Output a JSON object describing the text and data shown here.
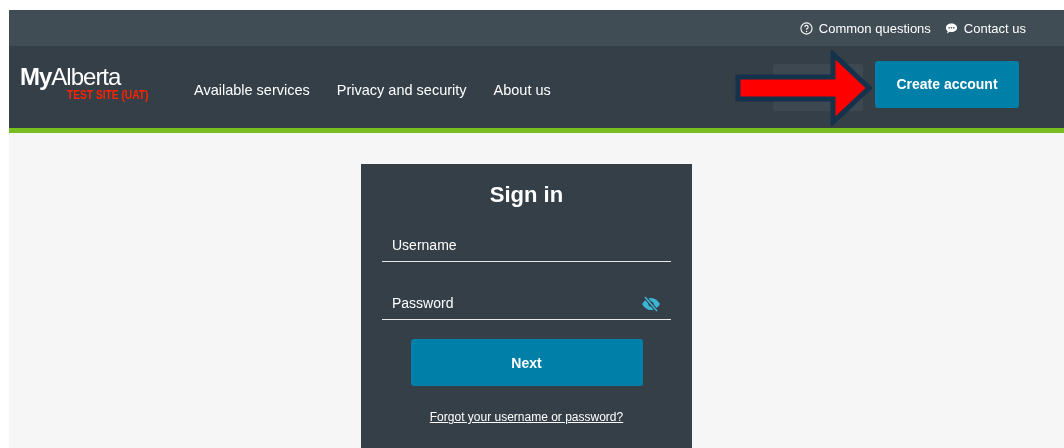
{
  "utility_links": [
    {
      "kind": "help",
      "label": "Common questions"
    },
    {
      "kind": "chat",
      "label": "Contact us"
    }
  ],
  "logo": {
    "bold": "My",
    "light": "Alberta",
    "tag": "TEST SITE (UAT)"
  },
  "nav": [
    "Available services",
    "Privacy and security",
    "About us"
  ],
  "create_account": "Create account",
  "sign_in": {
    "title": "Sign in",
    "fields": [
      {
        "placeholder": "Username",
        "kind": "text"
      },
      {
        "placeholder": "Password",
        "kind": "password"
      }
    ],
    "button": "Next",
    "link": "Forgot your username or password?"
  }
}
